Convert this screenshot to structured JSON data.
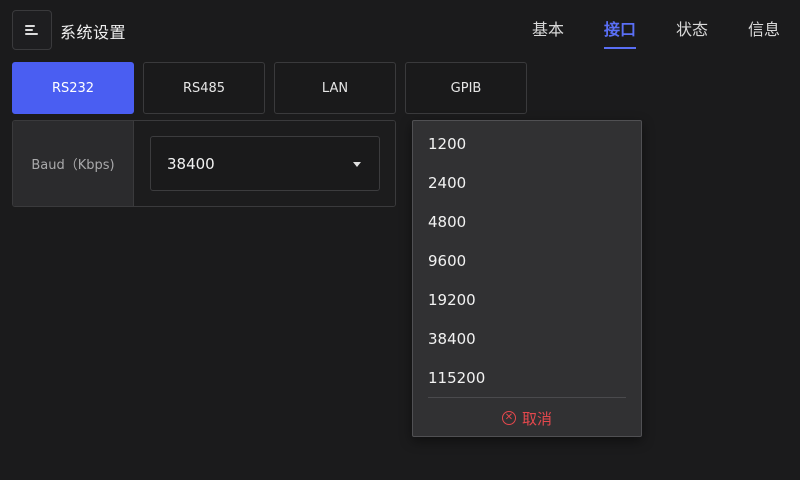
{
  "header": {
    "title": "系统设置",
    "menu_icon": "menu-icon",
    "tabs": [
      {
        "label": "基本",
        "active": false
      },
      {
        "label": "接口",
        "active": true
      },
      {
        "label": "状态",
        "active": false
      },
      {
        "label": "信息",
        "active": false
      }
    ]
  },
  "interface_tabs": [
    {
      "label": "RS232",
      "active": true
    },
    {
      "label": "RS485",
      "active": false
    },
    {
      "label": "LAN",
      "active": false
    },
    {
      "label": "GPIB",
      "active": false
    }
  ],
  "setting": {
    "label": "Baud（Kbps)",
    "value": "38400"
  },
  "dropdown": {
    "options": [
      "1200",
      "2400",
      "4800",
      "9600",
      "19200",
      "38400",
      "115200"
    ],
    "cancel_label": "取消"
  },
  "colors": {
    "accent": "#4a5ef2",
    "danger": "#e5484d",
    "background": "#1b1b1c"
  }
}
